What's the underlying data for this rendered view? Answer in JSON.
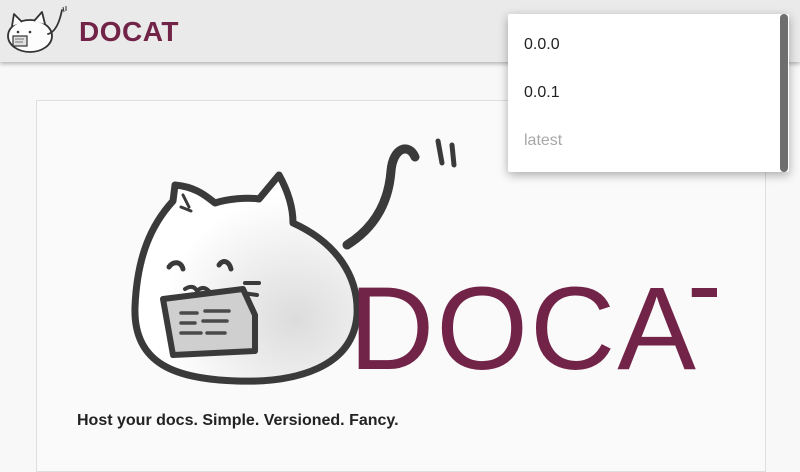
{
  "header": {
    "title": "DOCAT"
  },
  "main": {
    "logo_text": "DOCAT",
    "tagline": "Host your docs. Simple. Versioned. Fancy."
  },
  "version_menu": {
    "items": [
      {
        "label": "0.0.0",
        "disabled": false
      },
      {
        "label": "0.0.1",
        "disabled": false
      },
      {
        "label": "latest",
        "disabled": true
      }
    ]
  },
  "colors": {
    "brand": "#722348",
    "header_bg": "#eaeaea",
    "page_bg": "#f8f8f8"
  }
}
